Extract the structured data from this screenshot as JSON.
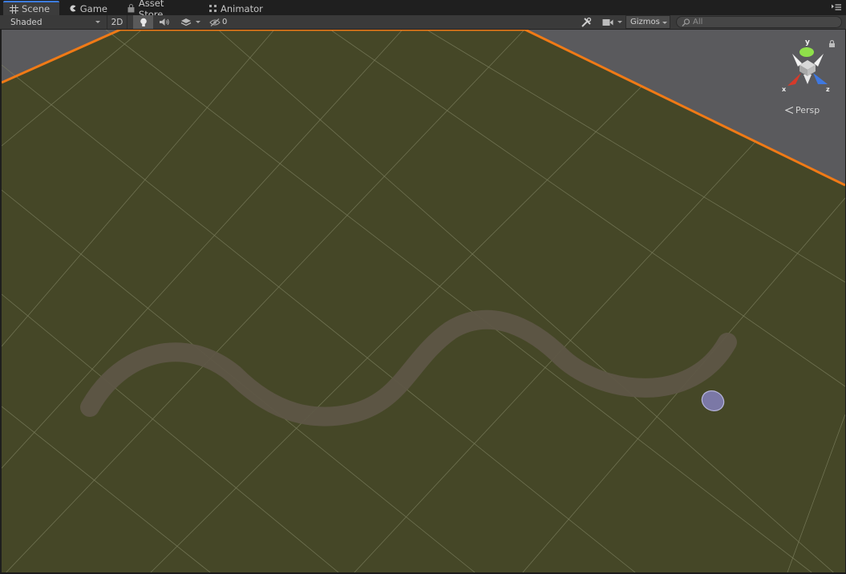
{
  "tabs": [
    {
      "label": "Scene",
      "icon": "scene-grid-icon",
      "active": true
    },
    {
      "label": "Game",
      "icon": "pacman-icon",
      "active": false
    },
    {
      "label": "Asset Store",
      "icon": "shopping-bag-icon",
      "active": false
    },
    {
      "label": "Animator",
      "icon": "animator-icon",
      "active": false
    }
  ],
  "toolbar": {
    "draw_mode": "Shaded",
    "mode_2d": "2D",
    "hidden_count": "0",
    "gizmos_label": "Gizmos",
    "search_placeholder": "All"
  },
  "viewport": {
    "projection_label": "Persp",
    "axis_labels": {
      "y": "y",
      "x": "x",
      "z": "z"
    }
  },
  "colors": {
    "ground": "#454727",
    "background": "#5a5a5d",
    "selection_outline": "#f07a16",
    "path": "#5e5646",
    "active_tab_accent": "#3d7de0",
    "axis_x": "#d63a2a",
    "axis_y": "#8fe04a",
    "axis_z": "#3f78e0"
  }
}
